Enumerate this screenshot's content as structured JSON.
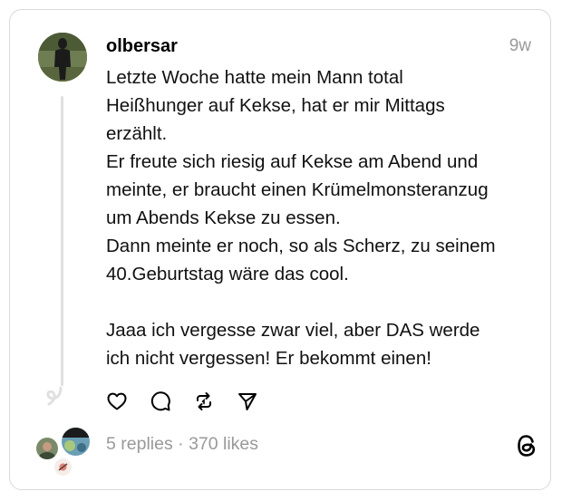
{
  "post": {
    "username": "olbersar",
    "time": "9w",
    "text": "Letzte Woche hatte mein Mann total\nHeißhunger auf Kekse, hat er mir Mittags\nerzählt.\nEr freute sich riesig auf Kekse am Abend und\nmeinte, er braucht einen Krümelmonsteranzug\num Abends Kekse zu essen.\nDann meinte er noch, so als Scherz, zu seinem\n40.Geburtstag wäre das cool.\n\nJaaa ich vergesse zwar viel, aber DAS werde\nich nicht vergessen! Er bekommt einen!",
    "replies": "5 replies",
    "separator": "·",
    "likes": "370 likes"
  },
  "icons": {
    "like": "heart-icon",
    "reply": "comment-icon",
    "repost": "repost-icon",
    "share": "send-icon",
    "brand": "threads-logo-icon"
  }
}
